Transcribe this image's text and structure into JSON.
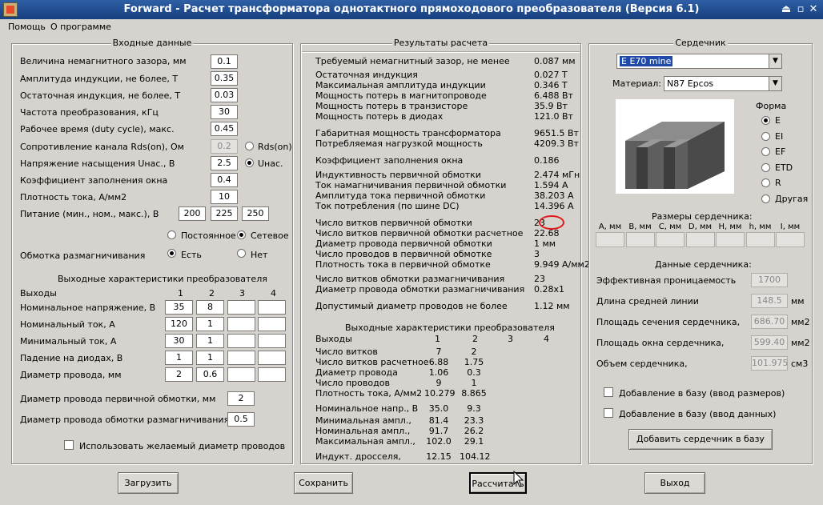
{
  "window": {
    "title": "Forward - Расчет трансформатора однотактного прямоходового преобразователя (Версия 6.1)"
  },
  "menu": {
    "help": "Помощь",
    "about": "О программе"
  },
  "input": {
    "title": "Входные данные",
    "gap": {
      "label": "Величина немагнитного зазора, мм",
      "value": "0.1"
    },
    "induction": {
      "label": "Амплитуда индукции, не более, Т",
      "value": "0.35"
    },
    "residual": {
      "label": "Остаточная индукция, не более, Т",
      "value": "0.03"
    },
    "freq": {
      "label": "Частота преобразования, кГц",
      "value": "30"
    },
    "duty": {
      "label": "Рабочее время (duty cycle), макс.",
      "value": "0.45"
    },
    "rds": {
      "label": "Сопротивление канала Rds(on), Ом",
      "value": "0.2",
      "radio": "Rds(on)"
    },
    "usat": {
      "label": "Напряжение насыщения Uнас., В",
      "value": "2.5",
      "radio": "Uнас."
    },
    "fill": {
      "label": "Коэффициент заполнения окна",
      "value": "0.4"
    },
    "density": {
      "label": "Плотность тока, А/мм2",
      "value": "10"
    },
    "supply": {
      "label": "Питание (мин., ном., макс.), В",
      "min": "200",
      "nom": "225",
      "max": "250"
    },
    "supply_type": {
      "dc": "Постоянное",
      "ac": "Сетевое"
    },
    "demag": {
      "label": "Обмотка размагничивания",
      "yes": "Есть",
      "no": "Нет"
    },
    "outputs_title": "Выходные характеристики преобразователя",
    "outputs_header": "Выходы",
    "cols": [
      "1",
      "2",
      "3",
      "4"
    ],
    "rows": [
      {
        "label": "Номинальное напряжение, В",
        "v": [
          "35",
          "8",
          "",
          ""
        ]
      },
      {
        "label": "Номинальный ток, А",
        "v": [
          "120",
          "1",
          "",
          ""
        ]
      },
      {
        "label": "Минимальный ток, А",
        "v": [
          "30",
          "1",
          "",
          ""
        ]
      },
      {
        "label": "Падение на диодах, В",
        "v": [
          "1",
          "1",
          "",
          ""
        ]
      },
      {
        "label": "Диаметр провода, мм",
        "v": [
          "2",
          "0.6",
          "",
          ""
        ]
      }
    ],
    "wire_primary": {
      "label": "Диаметр провода первичной обмотки, мм",
      "value": "2"
    },
    "wire_demag": {
      "label": "Диаметр провода обмотки размагничивания,",
      "value": "0.5"
    },
    "use_wire": "Использовать желаемый диаметр проводов"
  },
  "results": {
    "title": "Результаты расчета",
    "items": [
      {
        "label": "Требуемый немагнитный зазор, не менее",
        "value": "0.087 мм"
      },
      {
        "label": "Остаточная индукция",
        "value": "0.027 Т"
      },
      {
        "label": "Максимальная амплитуда индукции",
        "value": "0.346 Т"
      },
      {
        "label": "Мощность потерь в магнитопроводе",
        "value": "6.488 Вт"
      },
      {
        "label": "Мощность потерь в транзисторе",
        "value": "35.9 Вт"
      },
      {
        "label": "Мощность потерь в диодах",
        "value": "121.0 Вт"
      },
      {
        "label": "Габаритная мощность трансформатора",
        "value": "9651.5 Вт"
      },
      {
        "label": "Потребляемая нагрузкой мощность",
        "value": "4209.3 Вт"
      },
      {
        "label": "Коэффициент заполнения окна",
        "value": "0.186"
      },
      {
        "label": "Индуктивность первичной обмотки",
        "value": "2.474 мГн"
      },
      {
        "label": "Ток намагничивания первичной обмотки",
        "value": "1.594 А"
      },
      {
        "label": "Амплитуда тока первичной обмотки",
        "value": "38.203 А"
      },
      {
        "label": "Ток потребления (по шине DC)",
        "value": "14.396 А"
      },
      {
        "label": "Число витков первичной обмотки",
        "value": "23"
      },
      {
        "label": "Число витков первичной обмотки расчетное",
        "value": "22.68"
      },
      {
        "label": "Диаметр провода первичной обмотки",
        "value": "1 мм"
      },
      {
        "label": "Число проводов в первичной обмотке",
        "value": "3"
      },
      {
        "label": "Плотность тока в первичной обмотке",
        "value": "9.949 А/мм2"
      },
      {
        "label": "Число витков обмотки размагничивания",
        "value": "23"
      },
      {
        "label": "Диаметр провода обмотки размагничивания",
        "value": "0.28x1"
      },
      {
        "label": "Допустимый диаметр проводов не более",
        "value": "1.12 мм"
      }
    ],
    "outputs_title": "Выходные характеристики преобразователя",
    "outputs_header": "Выходы",
    "cols": [
      "1",
      "2",
      "3",
      "4"
    ],
    "rows": [
      {
        "label": "Число витков",
        "v": [
          "7",
          "2"
        ]
      },
      {
        "label": "Число витков расчетное",
        "v": [
          "6.88",
          "1.75"
        ]
      },
      {
        "label": "Диаметр провода",
        "v": [
          "1.06",
          "0.3"
        ]
      },
      {
        "label": "Число проводов",
        "v": [
          "9",
          "1"
        ]
      },
      {
        "label": "Плотность тока, А/мм2",
        "v": [
          "10.279",
          "8.865"
        ]
      },
      {
        "label": "Номинальное напр., В",
        "v": [
          "35.0",
          "9.3"
        ]
      },
      {
        "label": "Минимальная ампл.,",
        "v": [
          "81.4",
          "23.3"
        ]
      },
      {
        "label": "Номинальная ампл.,",
        "v": [
          "91.7",
          "26.2"
        ]
      },
      {
        "label": "Максимальная ампл.,",
        "v": [
          "102.0",
          "29.1"
        ]
      },
      {
        "label": "Индукт. дросселя,",
        "v": [
          "12.15",
          "104.12"
        ]
      }
    ]
  },
  "core": {
    "title": "Сердечник",
    "selected": "E E70 mine",
    "material_label": "Материал:",
    "material": "N87 Epcos",
    "shape_label": "Форма",
    "shapes": [
      "E",
      "EI",
      "EF",
      "ETD",
      "R",
      "Другая"
    ],
    "dims_title": "Размеры сердечника:",
    "dims": [
      "A, мм",
      "B, мм",
      "C, мм",
      "D, мм",
      "H, мм",
      "h, мм",
      "I, мм"
    ],
    "data_title": "Данные сердечника:",
    "permeability": {
      "label": "Эффективная проницаемость",
      "value": "1700"
    },
    "path": {
      "label": "Длина средней линии",
      "value": "148.5",
      "unit": "мм"
    },
    "area": {
      "label": "Площадь сечения сердечника,",
      "value": "686.70",
      "unit": "мм2"
    },
    "window": {
      "label": "Площадь окна сердечника,",
      "value": "599.40",
      "unit": "мм2"
    },
    "volume": {
      "label": "Объем сердечника,",
      "value": "101.975",
      "unit": "см3"
    },
    "add_dims": "Добавление в базу (ввод размеров)",
    "add_data": "Добавление в базу (ввод данных)",
    "add_button": "Добавить сердечник в базу"
  },
  "buttons": {
    "load": "Загрузить",
    "save": "Сохранить",
    "calc": "Рассчитать",
    "exit": "Выход"
  }
}
